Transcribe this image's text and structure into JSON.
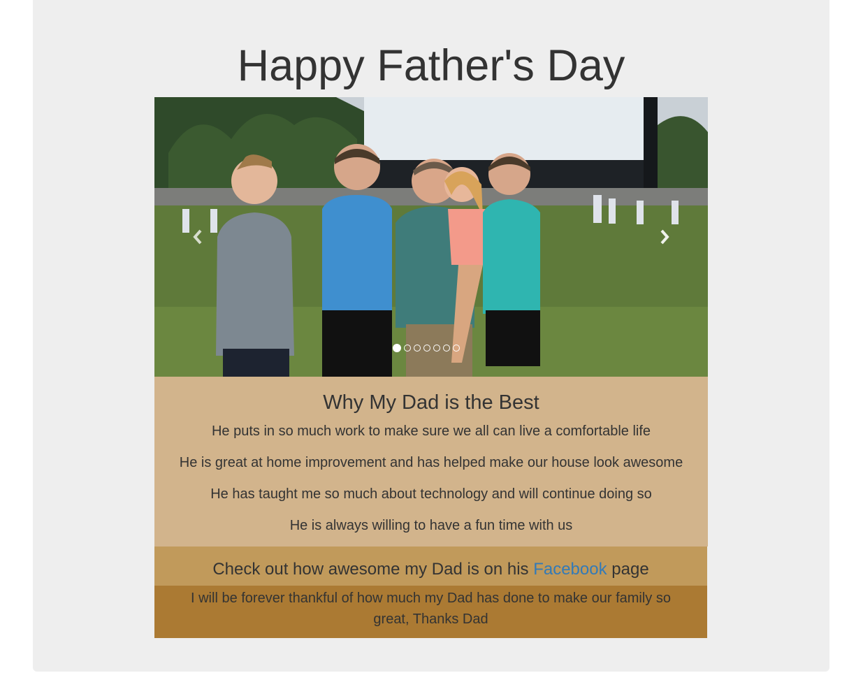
{
  "title": "Happy Father's Day",
  "carousel": {
    "slide_count": 7,
    "active_index": 0,
    "prev_icon": "chevron-left-icon",
    "next_icon": "chevron-right-icon"
  },
  "reasons": {
    "heading": "Why My Dad is the Best",
    "items": [
      "He puts in so much work to make sure we all can live a comfortable life",
      "He is great at home improvement and has helped make our house look awesome",
      "He has taught me so much about technology and will continue doing so",
      "He is always willing to have a fun time with us"
    ]
  },
  "facebook": {
    "before": "Check out how awesome my Dad is on his ",
    "link": "Facebook",
    "after": " page"
  },
  "thanks": "I will be forever thankful of how much my Dad has done to make our family so great, Thanks Dad",
  "colors": {
    "page_background": "#eeeeee",
    "reasons_band": "#d2b48c",
    "facebook_band": "#c19a5b",
    "thanks_band": "#ab7a33",
    "link": "#337ab7"
  }
}
